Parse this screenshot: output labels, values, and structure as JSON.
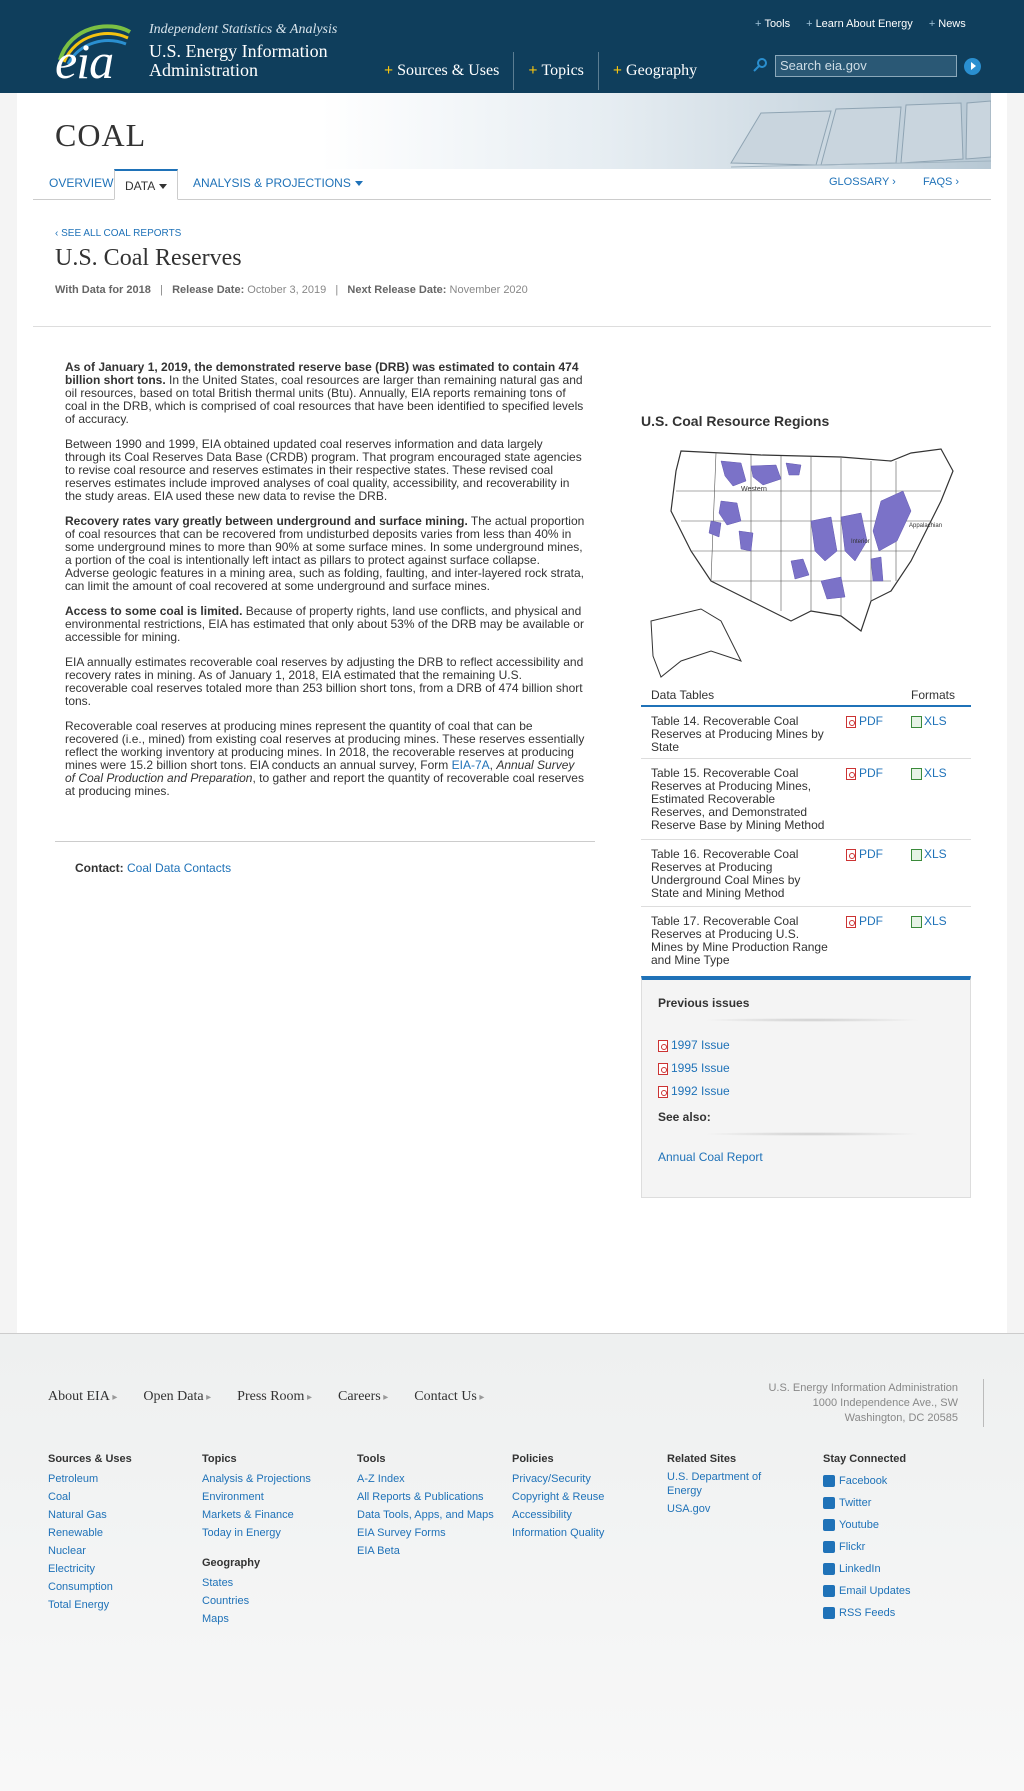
{
  "header": {
    "logo_text": "eia",
    "tagline": "Independent Statistics & Analysis",
    "org_name": "U.S. Energy Information Administration",
    "main_nav": [
      "Sources & Uses",
      "Topics",
      "Geography"
    ],
    "util_nav": [
      "Tools",
      "Learn About Energy",
      "News"
    ],
    "search_placeholder": "Search eia.gov"
  },
  "banner": {
    "title": "COAL"
  },
  "subnav": {
    "overview": "OVERVIEW",
    "data": "DATA",
    "analysis": "ANALYSIS & PROJECTIONS",
    "glossary": "GLOSSARY ›",
    "faqs": "FAQS ›"
  },
  "report": {
    "crumb": "‹ SEE ALL COAL REPORTS",
    "title": "U.S. Coal Reserves",
    "with_data_label": "With Data for 2018",
    "release_label": "Release Date:",
    "release_date": "October 3, 2019",
    "next_label": "Next Release Date:",
    "next_date": "November 2020"
  },
  "body": {
    "p1_bold": "As of January 1, 2019, the demonstrated reserve base (DRB) was estimated to contain 474 billion short tons.",
    "p1_rest": " In the United States, coal resources are larger than remaining natural gas and oil resources, based on total British thermal units (Btu). Annually, EIA reports remaining tons of coal in the DRB, which is comprised of coal resources that have been identified to specified levels of accuracy.",
    "p2": "Between 1990 and 1999, EIA obtained updated coal reserves information and data largely through its Coal Reserves Data Base (CRDB) program. That program encouraged state agencies to revise coal resource and reserves estimates in their respective states. These revised coal reserves estimates include improved analyses of coal quality, accessibility, and recoverability in the study areas. EIA used these new data to revise the DRB.",
    "p3_bold": "Recovery rates vary greatly between underground and surface mining.",
    "p3_rest": " The actual proportion of coal resources that can be recovered from undisturbed deposits varies from less than 40% in some underground mines to more than 90% at some surface mines. In some underground mines, a portion of the coal is intentionally left intact as pillars to protect against surface collapse. Adverse geologic features in a mining area, such as folding, faulting, and inter-layered rock strata, can limit the amount of coal recovered at some underground and surface mines.",
    "p4_bold": "Access to some coal is limited.",
    "p4_rest": " Because of property rights, land use conflicts, and physical and environmental restrictions, EIA has estimated that only about 53% of the DRB may be available or accessible for mining.",
    "p5": "EIA annually estimates recoverable coal reserves by adjusting the DRB to reflect accessibility and recovery rates in mining. As of January 1, 2018, EIA estimated that the remaining U.S. recoverable coal reserves totaled more than 253 billion short tons, from a DRB of 474 billion short tons.",
    "p6_a": "Recoverable coal reserves at producing mines represent the quantity of coal that can be recovered (i.e., mined) from existing coal reserves at producing mines. These reserves essentially reflect the working inventory at producing mines. In 2018, the recoverable reserves at producing mines were 15.2 billion short tons. EIA conducts an annual survey, Form ",
    "p6_link": "EIA-7A",
    "p6_b": ", ",
    "p6_italic": "Annual Survey of Coal Production and Preparation",
    "p6_c": ", to gather and report the quantity of recoverable coal reserves at producing mines.",
    "contact_label": "Contact:",
    "contact_link": "Coal Data Contacts"
  },
  "sidebar": {
    "map_title": "U.S. Coal Resource Regions",
    "map_labels": {
      "western": "Western",
      "interior": "Interior",
      "appalachian": "Appalachian"
    },
    "tables_header": "Data Tables",
    "formats_header": "Formats",
    "tables": [
      {
        "desc": "Table 14. Recoverable Coal Reserves at Producing Mines by State",
        "pdf": "PDF",
        "xls": "XLS"
      },
      {
        "desc": "Table 15. Recoverable Coal Reserves at Producing Mines, Estimated Recoverable Reserves, and Demonstrated Reserve Base by Mining Method",
        "pdf": "PDF",
        "xls": "XLS"
      },
      {
        "desc": "Table 16. Recoverable Coal Reserves at Producing Underground Coal Mines by State and Mining Method",
        "pdf": "PDF",
        "xls": "XLS"
      },
      {
        "desc": "Table 17. Recoverable Coal Reserves at Producing U.S. Mines by Mine Production Range and Mine Type",
        "pdf": "PDF",
        "xls": "XLS"
      }
    ],
    "previous_title": "Previous issues",
    "issues": [
      "1997 Issue",
      "1995 Issue",
      "1992 Issue"
    ],
    "see_also_title": "See also:",
    "see_also_link": "Annual Coal Report"
  },
  "footer": {
    "nav": [
      "About EIA",
      "Open Data",
      "Press Room",
      "Careers",
      "Contact Us"
    ],
    "address": [
      "U.S. Energy Information Administration",
      "1000 Independence Ave., SW",
      "Washington, DC 20585"
    ],
    "columns": [
      {
        "title": "Sources & Uses",
        "links": [
          "Petroleum",
          "Coal",
          "Natural Gas",
          "Renewable",
          "Nuclear",
          "Electricity",
          "Consumption",
          "Total Energy"
        ]
      },
      {
        "title": "Topics",
        "links": [
          "Analysis & Projections",
          "Environment",
          "Markets & Finance",
          "Today in Energy"
        ]
      },
      {
        "title": "Tools",
        "links": [
          "A-Z Index",
          "All Reports & Publications",
          "Data Tools, Apps, and Maps",
          "EIA Survey Forms",
          "EIA Beta"
        ]
      },
      {
        "title": "Policies",
        "links": [
          "Privacy/Security",
          "Copyright & Reuse",
          "Accessibility",
          "Information Quality"
        ]
      },
      {
        "title": "Related Sites",
        "links": [
          "U.S. Department of Energy",
          "USA.gov"
        ]
      },
      {
        "title": "Stay Connected",
        "links": [
          "Facebook",
          "Twitter",
          "Youtube",
          "Flickr",
          "LinkedIn",
          "Email Updates",
          "RSS Feeds"
        ]
      }
    ],
    "geography": {
      "title": "Geography",
      "links": [
        "States",
        "Countries",
        "Maps"
      ]
    }
  }
}
